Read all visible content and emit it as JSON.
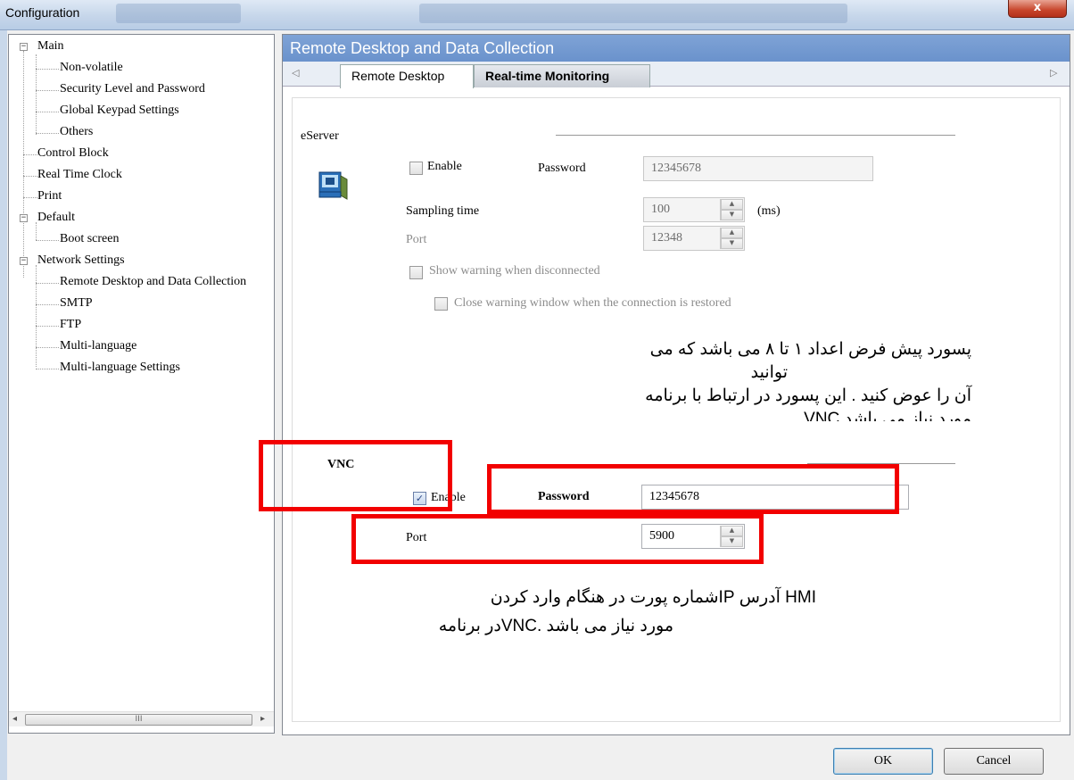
{
  "window": {
    "title": "Configuration",
    "close_glyph": "x"
  },
  "tree": {
    "items": [
      {
        "label": "Main",
        "expander": "−"
      },
      {
        "label": "Non-volatile"
      },
      {
        "label": "Security Level and Password"
      },
      {
        "label": "Global Keypad Settings"
      },
      {
        "label": "Others"
      },
      {
        "label": "Control Block"
      },
      {
        "label": "Real Time Clock"
      },
      {
        "label": "Print"
      },
      {
        "label": "Default",
        "expander": "−"
      },
      {
        "label": "Boot screen"
      },
      {
        "label": "Network Settings",
        "expander": "−"
      },
      {
        "label": "Remote Desktop and Data Collection"
      },
      {
        "label": "SMTP"
      },
      {
        "label": "FTP"
      },
      {
        "label": "Multi-language"
      },
      {
        "label": "Multi-language Settings"
      }
    ],
    "scroll_left": "◂",
    "scroll_right": "▸",
    "scroll_grip": "III"
  },
  "panel": {
    "title": "Remote Desktop and Data Collection",
    "tab_prev": "◁",
    "tab_next": "▷",
    "tabs": [
      {
        "label": "Remote Desktop",
        "active": true
      },
      {
        "label": "Real-time Monitoring",
        "active": false
      }
    ]
  },
  "eserver": {
    "section_label": "eServer",
    "icon": "server-monitor-icon",
    "enable_label": "Enable",
    "enable_checked": false,
    "password_label": "Password",
    "password_value": "12345678",
    "sampling_label": "Sampling time",
    "sampling_value": "100",
    "sampling_unit": "(ms)",
    "port_label": "Port",
    "port_value": "12348",
    "show_warning_label": "Show warning when disconnected",
    "close_warning_label": "Close warning window when the connection is restored"
  },
  "vnc": {
    "section_label": "VNC",
    "enable_label": "Enable",
    "enable_checked": true,
    "password_label": "Password",
    "password_value": "12345678",
    "port_label": "Port",
    "port_value": "5900"
  },
  "annotations": {
    "note1_line1": "پسورد پیش فرض اعداد ۱ تا ۸ می باشد  که می",
    "note1_line2": "توانید",
    "note1_line3": "آن را عوض کنید . این پسورد در ارتباط با برنامه",
    "note1_line4": "مورد نیاز می باشد VNC",
    "note2_line1": "HMI آدرس IPشماره پورت در هنگام وارد کردن",
    "note2_line2": "مورد نیاز می باشد .VNCدر برنامه",
    "highlight_color": "#f20000"
  },
  "footer": {
    "ok_label": "OK",
    "cancel_label": "Cancel"
  },
  "spinner": {
    "up": "▲",
    "down": "▼"
  },
  "check_glyph": "✓",
  "colors": {
    "header_bg": "#6a92cc",
    "close_bg": "#c7452b"
  }
}
